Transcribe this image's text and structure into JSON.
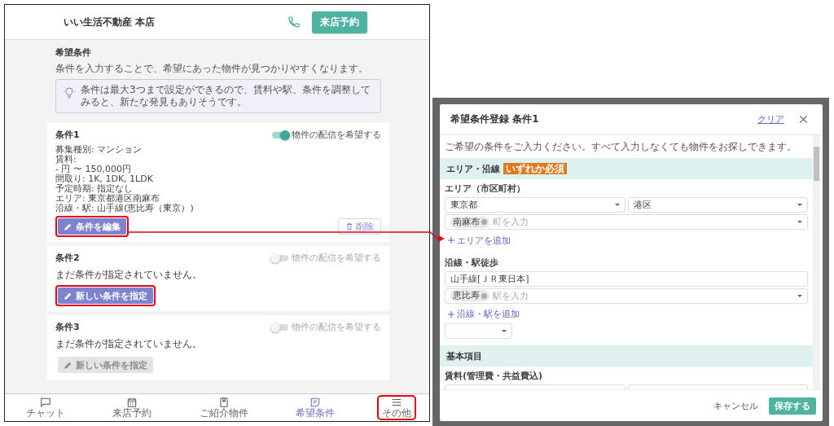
{
  "app": {
    "shop_name": "いい生活不動産 本店",
    "reserve_button": "来店予約"
  },
  "page": {
    "title": "希望条件",
    "description": "条件を入力することで、希望にあった物件が見つかりやすくなります。",
    "tip": "条件は最大3つまで設定ができるので、賃料や駅、条件を調整してみると、新たな発見もありそうです。"
  },
  "conditions": [
    {
      "kind": "filled",
      "title": "条件1",
      "notify_label": "物件の配信を希望する",
      "notify_on": true,
      "notify_disabled": false,
      "details": [
        "募集種別: マンション",
        "賃料:",
        "- 円 〜 150,000円",
        "間取り: 1K, 1DK, 1LDK",
        "予定時期: 指定なし",
        "エリア: 東京都港区南麻布",
        "沿線・駅: 山手線(恵比寿（東京）)"
      ],
      "edit_button": {
        "label": "条件を編集",
        "highlighted": true
      },
      "delete_button": "削除"
    },
    {
      "kind": "empty",
      "title": "条件2",
      "notify_label": "物件の配信を希望する",
      "notify_on": false,
      "notify_disabled": true,
      "empty_text": "まだ条件が指定されていません。",
      "new_button": {
        "label": "新しい条件を指定",
        "disabled": false,
        "highlighted": true
      }
    },
    {
      "kind": "empty",
      "title": "条件3",
      "notify_label": "物件の配信を希望する",
      "notify_on": false,
      "notify_disabled": true,
      "empty_text": "まだ条件が指定されていません。",
      "new_button": {
        "label": "新しい条件を指定",
        "disabled": true,
        "highlighted": false
      }
    }
  ],
  "nav": [
    {
      "label": "チャット",
      "selected": false,
      "highlighted": false
    },
    {
      "label": "来店予約",
      "selected": false,
      "highlighted": false
    },
    {
      "label": "ご紹介物件",
      "selected": false,
      "highlighted": false
    },
    {
      "label": "希望条件",
      "selected": true,
      "highlighted": false
    },
    {
      "label": "その他",
      "selected": false,
      "highlighted": true
    }
  ],
  "modal": {
    "title": "希望条件登録 条件1",
    "clear_link": "クリア",
    "intro": "ご希望の条件をご入力ください。すべて入力しなくても物件をお探しできます。",
    "area_section": {
      "title": "エリア・沿線",
      "badge": "いずれか必須",
      "area_label": "エリア（市区町村）",
      "prefecture": "東京都",
      "city": "港区",
      "town_tags": [
        "南麻布"
      ],
      "town_placeholder": "町を入力",
      "add_area": "エリアを追加",
      "line_label": "沿線・駅徒歩",
      "line": "山手線[ＪＲ東日本]",
      "station_tags": [
        "恵比寿"
      ],
      "station_placeholder": "駅を入力",
      "add_line": "沿線・駅を追加"
    },
    "basic_section": {
      "title": "基本項目",
      "rent_label": "賃料(管理費・共益費込)"
    },
    "cancel_button": "キャンセル",
    "save_button": "保存する"
  }
}
